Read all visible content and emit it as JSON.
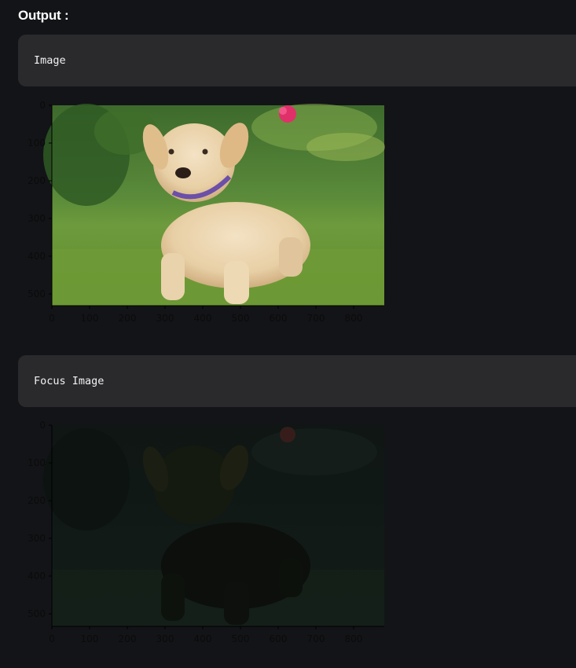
{
  "output_heading": "Output :",
  "sections": [
    {
      "code_label": "Image",
      "x_ticks": [
        "0",
        "100",
        "200",
        "300",
        "400",
        "500",
        "600",
        "700",
        "800"
      ],
      "y_ticks": [
        "0",
        "100",
        "200",
        "300",
        "400",
        "500"
      ],
      "brightness": "full"
    },
    {
      "code_label": "Focus Image",
      "x_ticks": [
        "0",
        "100",
        "200",
        "300",
        "400",
        "500",
        "600",
        "700",
        "800"
      ],
      "y_ticks": [
        "0",
        "100",
        "200",
        "300",
        "400",
        "500"
      ],
      "brightness": "dimmed"
    }
  ],
  "colors": {
    "background": "#131417",
    "code_box": "#2a2a2d",
    "text": "#ffffff",
    "tick_text": "#0b0b0b"
  }
}
